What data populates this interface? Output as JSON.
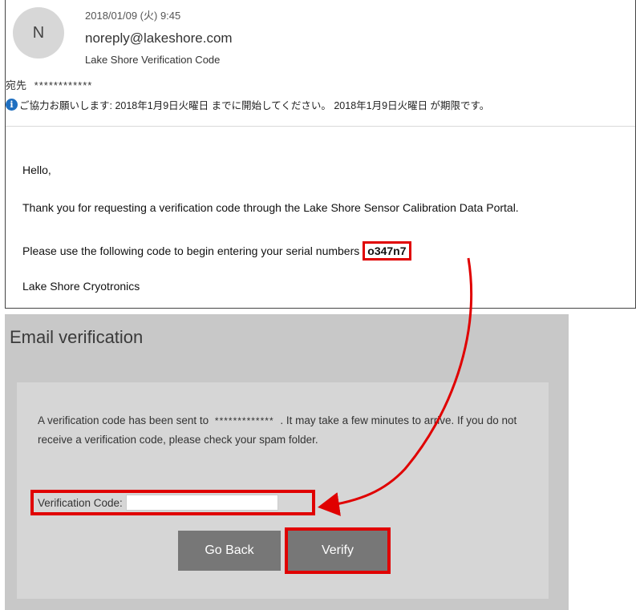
{
  "email": {
    "avatar_initial": "N",
    "date": "2018/01/09 (火) 9:45",
    "from": "noreply@lakeshore.com",
    "subject": "Lake Shore Verification Code",
    "to_label": "宛先",
    "to_value": "************",
    "info_text": "ご協力お願いします: 2018年1月9日火曜日 までに開始してください。 2018年1月9日火曜日 が期限です。",
    "body": {
      "greeting": "Hello,",
      "thanks": "Thank you for requesting a verification code through the Lake Shore Sensor Calibration Data Portal.",
      "instruction": "Please use the following code to begin entering your serial numbers",
      "code": "o347n7",
      "signature": "Lake Shore Cryotronics"
    }
  },
  "verification": {
    "title": "Email verification",
    "message_part1": "A verification code has been sent to",
    "masked_email": "*************",
    "message_part2": ". It may take a few minutes to arrive. If you do not receive a verification code, please check your spam folder.",
    "code_label": "Verification Code:",
    "code_value": "",
    "back_label": "Go Back",
    "verify_label": "Verify"
  },
  "annotation": {
    "highlight_color": "#e00000",
    "arrow": "from email code to verification code field"
  }
}
